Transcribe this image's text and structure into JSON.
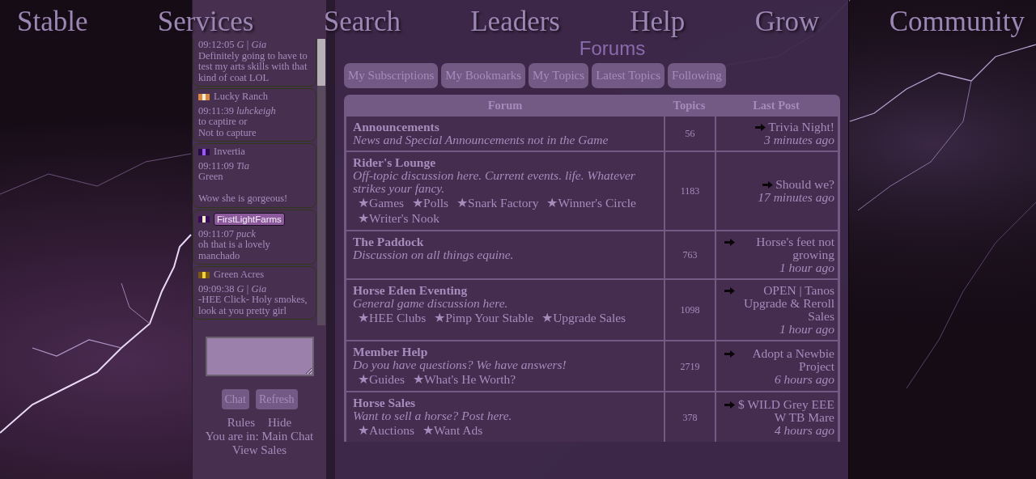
{
  "nav": [
    {
      "label": "Stable"
    },
    {
      "label": "Services"
    },
    {
      "label": "Search"
    },
    {
      "label": "Leaders"
    },
    {
      "label": "Help"
    },
    {
      "label": "Grow"
    },
    {
      "label": "Community"
    }
  ],
  "chat": {
    "messages": [
      {
        "time": "09:12:05",
        "tag": "G",
        "separator": "|",
        "user": "Gia",
        "text": "Definitely going to have to test my arts skills with that kind of coat LOL"
      },
      {
        "stable": "Lucky Ranch",
        "highlighted": false,
        "stripes": [
          {
            "color": "#d8883a"
          },
          {
            "color": "#f2e8d8"
          },
          {
            "color": "#d8883a"
          }
        ],
        "time": "09:11:39",
        "user": "luhckeigh",
        "text": "to captire or\nNot to capture"
      },
      {
        "stable": "Invertia",
        "highlighted": false,
        "stripes": [
          {
            "color": "#2c0a4e"
          },
          {
            "color": "#9a5cf0"
          },
          {
            "color": "#2c0a4e"
          }
        ],
        "time": "09:11:09",
        "user": "Tia",
        "text": "Green\n\nWow she is gorgeous!"
      },
      {
        "stable": "FirstLightFarms",
        "highlighted": true,
        "stripes": [
          {
            "color": "#3c0a5c"
          },
          {
            "color": "#f6f0c8"
          },
          {
            "color": "#3c0a5c"
          }
        ],
        "time": "09:11:07",
        "user": "puck",
        "text": "oh that is a lovely manchado"
      },
      {
        "stable": "Green Acres",
        "highlighted": false,
        "stripes": [
          {
            "color": "#7a5810"
          },
          {
            "color": "#f2d040"
          },
          {
            "color": "#7a5810"
          }
        ],
        "time": "09:09:38",
        "tag": "G",
        "separator": "|",
        "user": "Gia",
        "text": "-HEE Click- Holy smokes, look at you pretty girl"
      }
    ],
    "buttons": [
      "Chat",
      "Refresh"
    ],
    "links": [
      "Rules",
      "Hide"
    ],
    "location": "You are in: Main Chat",
    "sales_link": "View Sales"
  },
  "forums": {
    "title": "Forums",
    "tabs": [
      {
        "label": "My Subscriptions",
        "selected": false
      },
      {
        "label": "My Bookmarks",
        "selected": false
      },
      {
        "label": "My Topics",
        "selected": false
      },
      {
        "label": "Latest Topics",
        "selected": false
      },
      {
        "label": "Following",
        "selected": false
      }
    ],
    "columns": [
      "Forum",
      "Topics",
      "Last Post"
    ],
    "rows": [
      {
        "name": "Announcements",
        "description": "News and Special Announcements not in the Game",
        "subforums": [],
        "topics": "56",
        "last_post": "Trivia Night!",
        "last_time": "3 minutes ago"
      },
      {
        "name": "Rider's Lounge",
        "description": "Off-topic discussion here. Current events. life. Whatever strikes your fancy.",
        "subforums": [
          "★Games",
          "★Polls",
          "★Snark Factory",
          "★Winner's Circle",
          "★Writer's Nook"
        ],
        "topics": "1183",
        "last_post": "Should we?",
        "last_time": "17 minutes ago"
      },
      {
        "name": "The Paddock",
        "description": "Discussion on all things equine.",
        "subforums": [],
        "topics": "763",
        "last_post": "Horse's feet not growing",
        "last_time": "1 hour ago"
      },
      {
        "name": "Horse Eden Eventing",
        "description": "General game discussion here.",
        "subforums": [
          "★HEE Clubs",
          "★Pimp Your Stable",
          "★Upgrade Sales"
        ],
        "topics": "1098",
        "last_post": "OPEN | Tanos Upgrade & Reroll Sales",
        "last_time": "1 hour ago"
      },
      {
        "name": "Member Help",
        "description": "Do you have questions? We have answers!",
        "subforums": [
          "★Guides",
          "★What's He Worth?"
        ],
        "topics": "2719",
        "last_post": "Adopt a Newbie Project",
        "last_time": "6 hours ago"
      },
      {
        "name": "Horse Sales",
        "description": "Want to sell a horse? Post here.",
        "subforums": [
          "★Auctions",
          "★Want Ads"
        ],
        "topics": "378",
        "last_post": "$ WILD Grey EEE W TB Mare",
        "last_time": "4 hours ago"
      }
    ]
  }
}
